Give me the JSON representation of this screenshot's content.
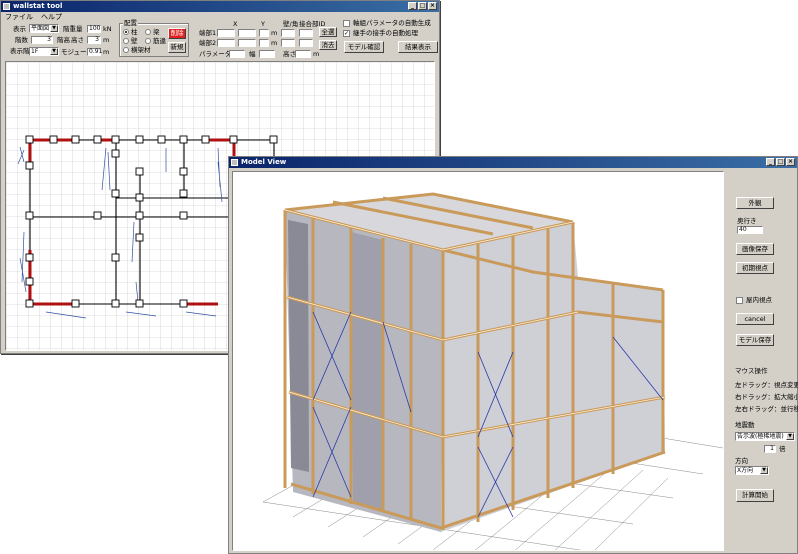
{
  "wall_window": {
    "title": "wallstat tool",
    "menu": [
      "ファイル",
      "ヘルプ"
    ],
    "display_label": "表示",
    "display_value": "平面図",
    "floors_label": "階数",
    "floors_value": "3",
    "display_floor_label": "表示階",
    "display_floor_value": "1F",
    "weight_label": "階重量",
    "weight_value": "100",
    "weight_unit": "kN",
    "floor_height_label": "階高",
    "floor_height_value": "3",
    "floor_height_unit": "m",
    "height_label": "高さ",
    "height_value": "3",
    "height_unit": "m",
    "module_label": "モジュール",
    "module_value": "0.91",
    "module_unit": "m",
    "placement_label": "配置",
    "radio_column": "柱",
    "radio_beam": "梁",
    "radio_wall": "壁",
    "radio_brace": "筋違",
    "radio_other": "横架材",
    "delete_button": "削除",
    "new_button": "新規",
    "col_x": "X",
    "col_y": "Y",
    "col_z": "Z",
    "col_angle": "壁/角",
    "col_joint": "接合部ID",
    "end1_label": "端部1",
    "end2_label": "端部2",
    "param_id_label": "パラメータID",
    "width_label": "幅",
    "height2_label": "高さ",
    "unit_m": "m",
    "all_button": "全選",
    "clear_button": "消去",
    "chk_auto_param": "軸組パラメータの自動生成",
    "chk_auto_joint": "継手の接手の自動処理",
    "model_check_button": "モデル確認",
    "result_button": "結果表示"
  },
  "model_window": {
    "title": "Model View",
    "exterior_button": "外観",
    "depth_label": "奥行き",
    "depth_value": "40",
    "save_image_button": "画像保存",
    "initial_view_button": "初期視点",
    "inner_view_label": "屋内視点",
    "cancel_button": "cancel",
    "save_model_button": "モデル保存",
    "mouse_title": "マウス操作",
    "mouse_left": "左ドラッグ：視点変更",
    "mouse_right": "右ドラッグ：拡大縮小",
    "mouse_both": "左右ドラッグ：並行移動",
    "ground_label": "地震動",
    "ground_value": "告示波(極稀地震)",
    "multiplier_value": "1",
    "multiplier_unit": "倍",
    "direction_label": "方向",
    "direction_value": "X方向",
    "start_button": "計算開始"
  },
  "colors": {
    "title_active": "#0a246a",
    "selected_wall": "#b01010",
    "delete_button": "#e02020",
    "timber": "#d9b27a",
    "brace": "#2a3aa8"
  }
}
